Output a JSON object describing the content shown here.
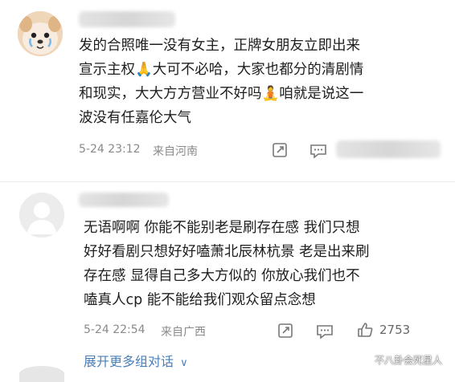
{
  "comments": [
    {
      "text": "发的合照唯一没有女主，正牌女朋友立即出来\n宣示主权🙏大可不必哈，大家也都分的清剧情\n和现实，大大方方营业不好吗🧘咱就是说这一\n波没有任嘉伦大气",
      "date": "5-24 23:12",
      "location": "来自河南"
    },
    {
      "text": "无语啊啊 你能不能别老是刷存在感 我们只想\n好好看剧只想好好嗑萧北辰林杭景 老是出来刷\n存在感 显得自己多大方似的 你放心我们也不\n嗑真人cp 能不能给我们观众留点念想",
      "date": "5-24 22:54",
      "location": "来自广西",
      "likes": "2753"
    }
  ],
  "expand": {
    "label": "展开更多组对话",
    "chevron": "∨"
  },
  "watermark": "不八卦会死星人",
  "icons": [
    "share-icon",
    "comment-icon",
    "like-icon",
    "chevron-down-icon"
  ],
  "colors": {
    "link": "#4a7fb8",
    "meta": "#8a8a8a",
    "text": "#1e1e1e"
  }
}
